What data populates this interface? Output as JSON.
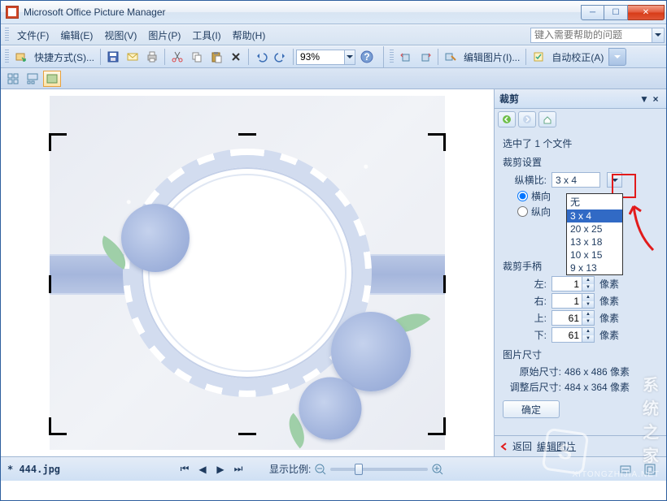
{
  "title": "Microsoft Office Picture Manager",
  "menu": {
    "file": "文件(F)",
    "edit": "编辑(E)",
    "view": "视图(V)",
    "picture": "图片(P)",
    "tools": "工具(I)",
    "help": "帮助(H)"
  },
  "help_placeholder": "键入需要帮助的问题",
  "toolbar": {
    "shortcut": "快捷方式(S)...",
    "zoom_value": "93%",
    "edit_pic": "编辑图片(I)...",
    "auto_correct": "自动校正(A)"
  },
  "taskpane": {
    "title": "裁剪",
    "selected": "选中了 1 个文件",
    "crop_settings": "裁剪设置",
    "ratio_label": "纵横比:",
    "ratio_value": "3 x 4",
    "orient_h": "横向",
    "orient_v": "纵向",
    "dd": {
      "none": "无",
      "o1": "3 x 4",
      "o2": "20 x 25",
      "o3": "13 x 18",
      "o4": "10 x 15",
      "o5": "9 x 13"
    },
    "handles": "裁剪手柄",
    "left_l": "左:",
    "left_v": "1",
    "right_l": "右:",
    "right_v": "1",
    "top_l": "上:",
    "top_v": "61",
    "bottom_l": "下:",
    "bottom_v": "61",
    "px": "像素",
    "size_section": "图片尺寸",
    "orig_l": "原始尺寸:",
    "orig_v": "486 x 486 像素",
    "new_l": "调整后尺寸:",
    "new_v": "484 x 364 像素",
    "ok": "确定",
    "back": "返回",
    "edit_link": "编辑图片"
  },
  "status": {
    "filename": "* 444.jpg",
    "zoom_label": "显示比例:"
  },
  "watermark": {
    "brand": "系统之家",
    "url": "XITONGZHIJIA.NET"
  }
}
